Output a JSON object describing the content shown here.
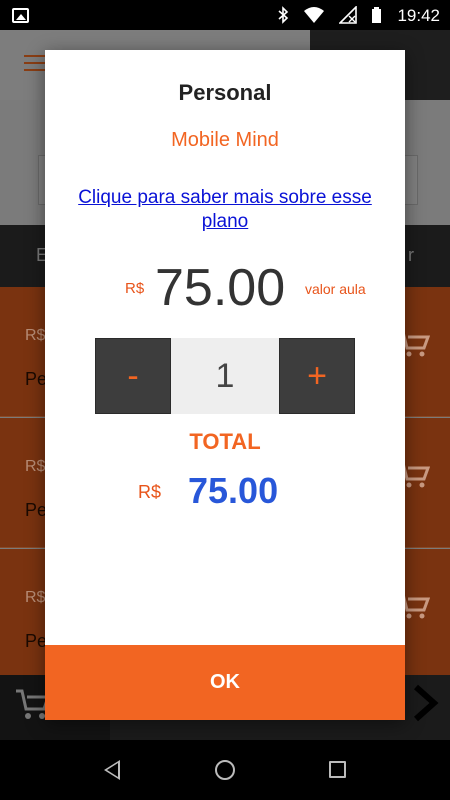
{
  "status_bar": {
    "time": "19:42"
  },
  "background": {
    "tabs": {
      "left": "E",
      "right": "r"
    },
    "items": [
      {
        "price": "R$",
        "name": "Pe"
      },
      {
        "price": "R$",
        "name": "Pe"
      },
      {
        "price": "R$",
        "name": "Pe"
      }
    ]
  },
  "dialog": {
    "title": "Personal",
    "subtitle": "Mobile Mind",
    "link": "Clique para saber mais sobre esse plano",
    "price": {
      "currency": "R$",
      "value": "75.00",
      "label": "valor aula"
    },
    "stepper": {
      "minus": "-",
      "quantity": "1",
      "plus": "+"
    },
    "total": {
      "label": "TOTAL",
      "currency": "R$",
      "value": "75.00"
    },
    "ok_label": "OK"
  },
  "colors": {
    "accent": "#f26522",
    "total_value": "#2857d9",
    "link": "#0a12d6"
  }
}
